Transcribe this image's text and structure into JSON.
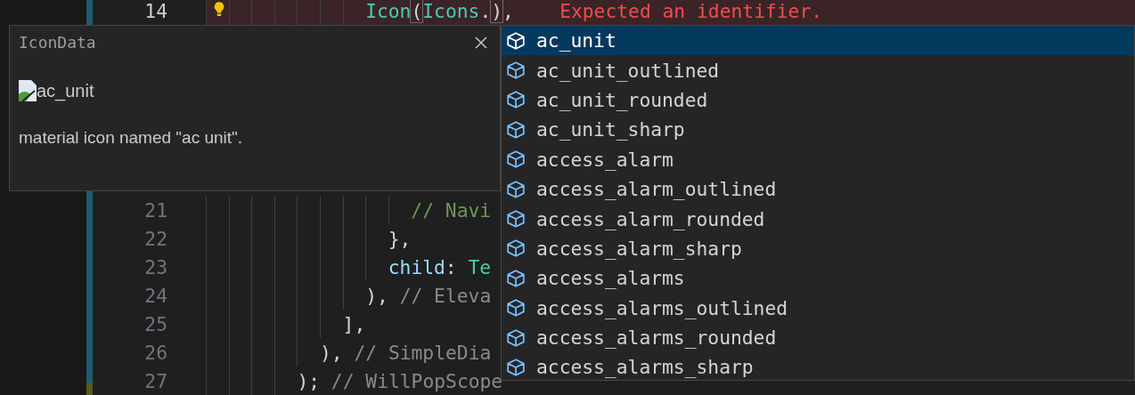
{
  "editor": {
    "lines_top": [
      {
        "number": "14",
        "current": true,
        "lightbulb": true,
        "tokens": [
          {
            "text": "              Icon",
            "kind": "type"
          },
          {
            "text": "(",
            "kind": "bracket"
          },
          {
            "text": "Icons",
            "kind": "type"
          },
          {
            "text": ".",
            "kind": "plain"
          },
          {
            "text": ")",
            "kind": "bracket"
          },
          {
            "text": ",",
            "kind": "plain"
          }
        ],
        "diagnostic": "Expected an identifier."
      }
    ],
    "lines_bottom": [
      {
        "number": "21",
        "current": false,
        "tokens": [
          {
            "text": "                  // Navi",
            "kind": "comment"
          }
        ]
      },
      {
        "number": "22",
        "current": false,
        "tokens": [
          {
            "text": "                },",
            "kind": "plain"
          }
        ]
      },
      {
        "number": "23",
        "current": false,
        "tokens": [
          {
            "text": "                child",
            "kind": "property"
          },
          {
            "text": ": ",
            "kind": "plain"
          },
          {
            "text": "Te",
            "kind": "type"
          }
        ]
      },
      {
        "number": "24",
        "current": false,
        "tokens": [
          {
            "text": "              ), ",
            "kind": "plain"
          },
          {
            "text": "// Eleva",
            "kind": "muted"
          }
        ]
      },
      {
        "number": "25",
        "current": false,
        "tokens": [
          {
            "text": "            ],",
            "kind": "plain"
          }
        ]
      },
      {
        "number": "26",
        "current": false,
        "tokens": [
          {
            "text": "          ), ",
            "kind": "plain"
          },
          {
            "text": "// SimpleDia",
            "kind": "muted"
          }
        ]
      },
      {
        "number": "27",
        "current": false,
        "tokens": [
          {
            "text": "        ); ",
            "kind": "plain"
          },
          {
            "text": "// WillPopScope",
            "kind": "muted"
          }
        ]
      }
    ]
  },
  "hover": {
    "title": "IconData",
    "image_alt": "ac_unit",
    "description": "material icon named \"ac unit\"."
  },
  "suggestions": [
    {
      "label": "ac_unit",
      "selected": true
    },
    {
      "label": "ac_unit_outlined",
      "selected": false
    },
    {
      "label": "ac_unit_rounded",
      "selected": false
    },
    {
      "label": "ac_unit_sharp",
      "selected": false
    },
    {
      "label": "access_alarm",
      "selected": false
    },
    {
      "label": "access_alarm_outlined",
      "selected": false
    },
    {
      "label": "access_alarm_rounded",
      "selected": false
    },
    {
      "label": "access_alarm_sharp",
      "selected": false
    },
    {
      "label": "access_alarms",
      "selected": false
    },
    {
      "label": "access_alarms_outlined",
      "selected": false
    },
    {
      "label": "access_alarms_rounded",
      "selected": false
    },
    {
      "label": "access_alarms_sharp",
      "selected": false
    }
  ]
}
